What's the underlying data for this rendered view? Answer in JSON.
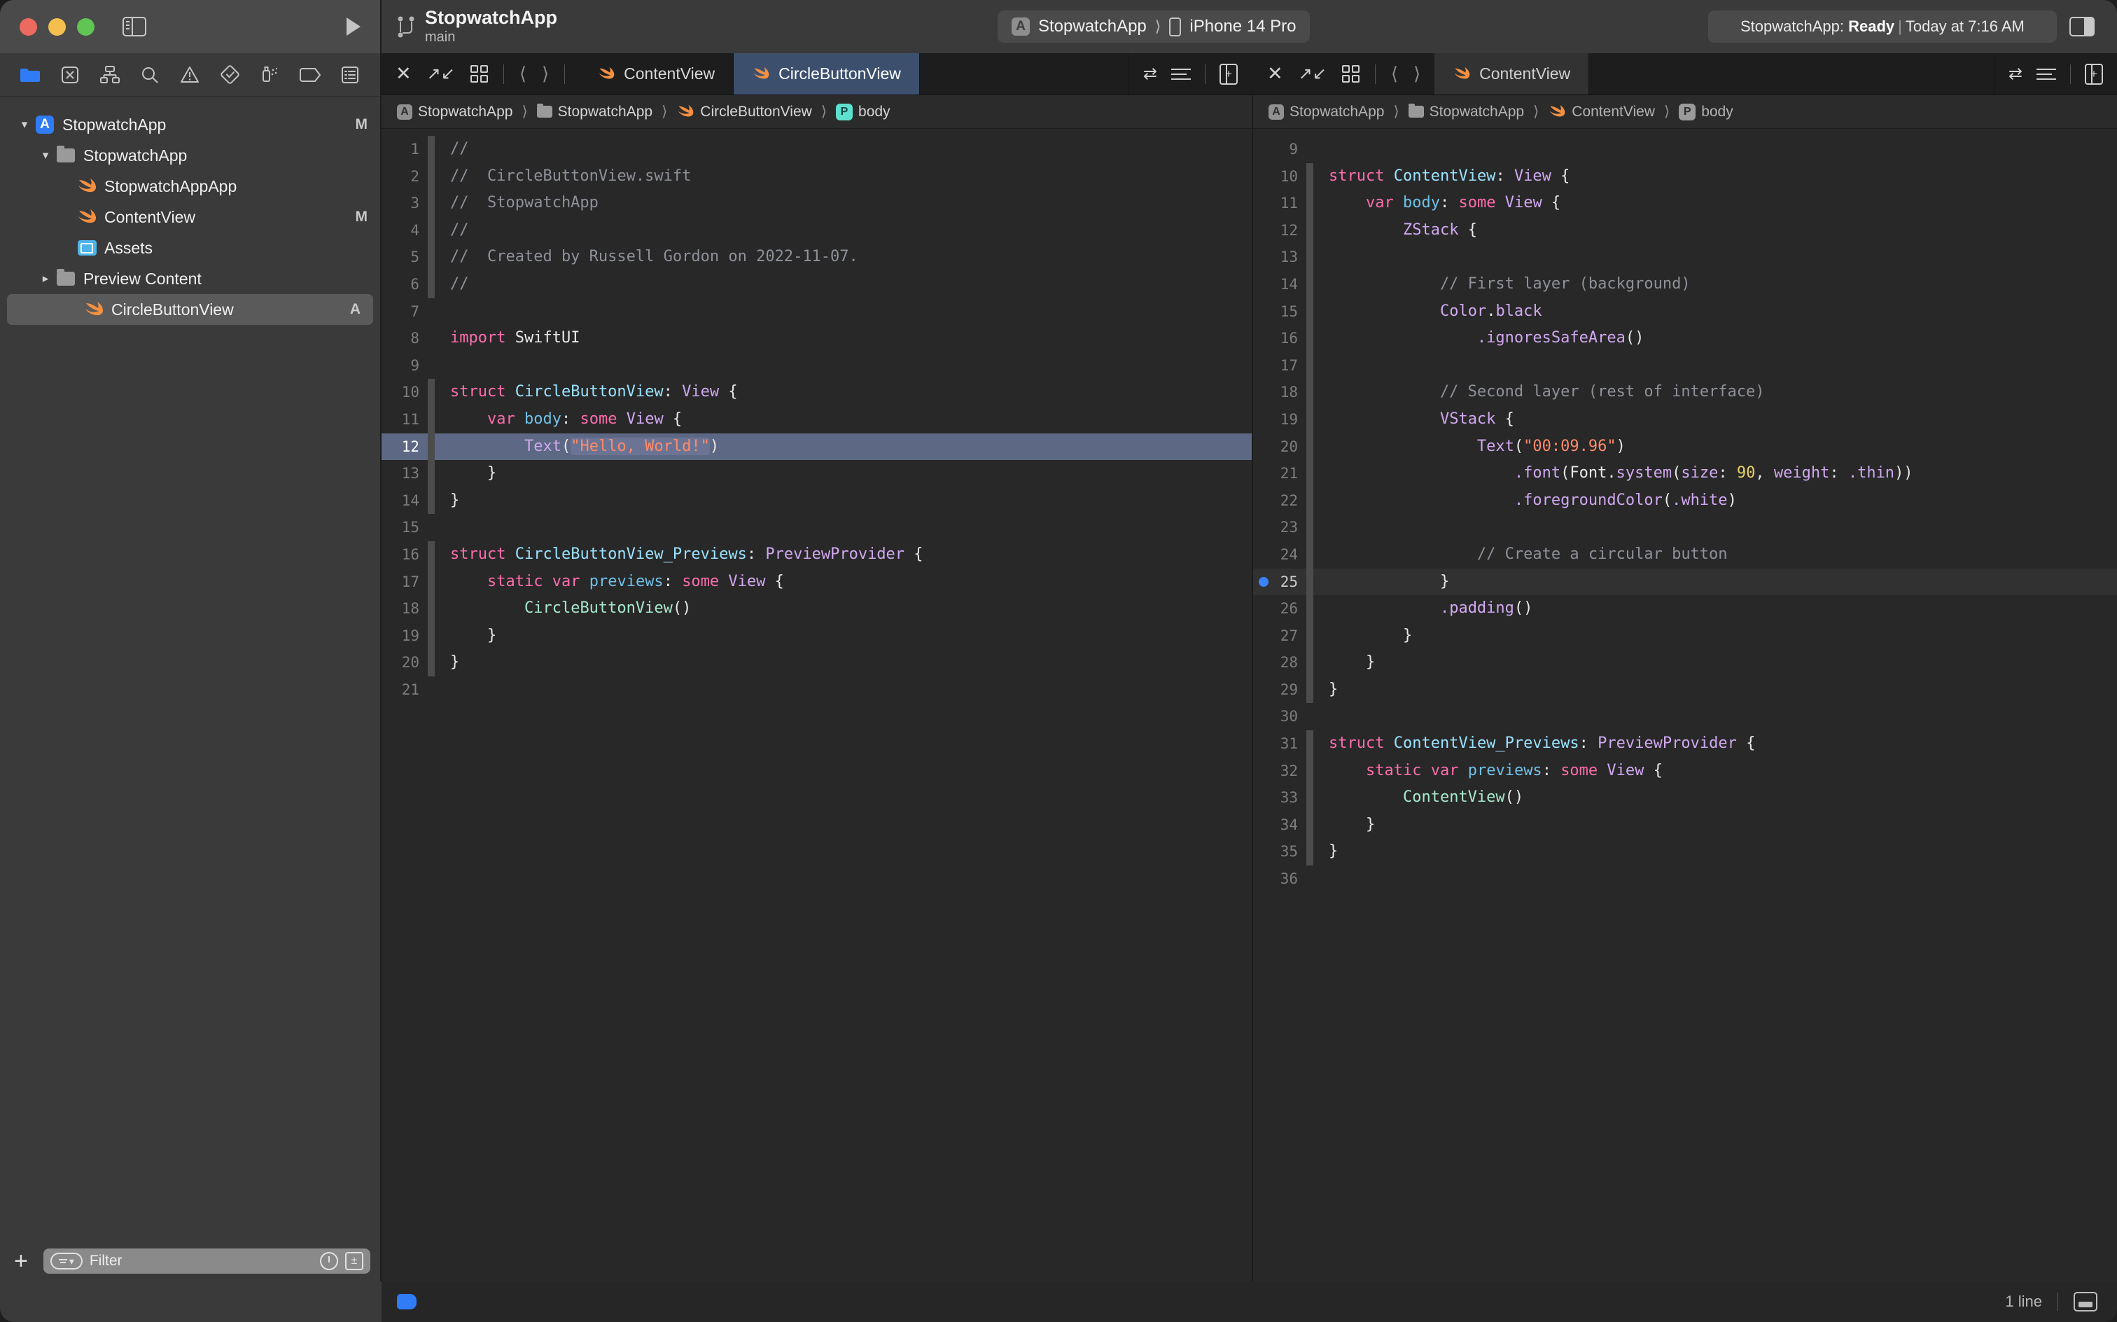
{
  "window": {
    "project_title": "StopwatchApp",
    "branch": "main",
    "traffic_lights": [
      "close-button",
      "minimize-button",
      "maximize-button"
    ]
  },
  "toolbar": {
    "scheme": "StopwatchApp",
    "destination": "iPhone 14 Pro",
    "status_prefix": "StopwatchApp: ",
    "status_state": "Ready",
    "status_suffix": "Today at 7:16 AM",
    "separator": "|",
    "add_label": "+"
  },
  "navigator": {
    "tabs": [
      "folder-icon",
      "source-control-icon",
      "hierarchy-icon",
      "search-icon",
      "warning-icon",
      "test-icon",
      "debug-icon",
      "breakpoint-icon",
      "report-icon"
    ],
    "tree": [
      {
        "label": "StopwatchApp",
        "icon": "xcodeproj-icon",
        "indent": 0,
        "twisty": "v",
        "badge": "M",
        "selected": false
      },
      {
        "label": "StopwatchApp",
        "icon": "folder-icon",
        "indent": 1,
        "twisty": "v",
        "badge": "",
        "selected": false
      },
      {
        "label": "StopwatchAppApp",
        "icon": "swift-icon",
        "indent": 2,
        "twisty": "",
        "badge": "",
        "selected": false
      },
      {
        "label": "ContentView",
        "icon": "swift-icon",
        "indent": 2,
        "twisty": "",
        "badge": "M",
        "selected": false
      },
      {
        "label": "Assets",
        "icon": "assets-icon",
        "indent": 2,
        "twisty": "",
        "badge": "",
        "selected": false
      },
      {
        "label": "Preview Content",
        "icon": "folder-icon",
        "indent": 1,
        "twisty": ">",
        "badge": "",
        "selected": false
      },
      {
        "label": "CircleButtonView",
        "icon": "swift-icon",
        "indent": 2,
        "twisty": "",
        "badge": "A",
        "selected": true
      }
    ],
    "filter_placeholder": "Filter"
  },
  "editor_left": {
    "tabs": [
      {
        "label": "ContentView",
        "state": "inactive"
      },
      {
        "label": "CircleButtonView",
        "state": "active"
      }
    ],
    "breadcrumb": [
      {
        "label": "StopwatchApp",
        "icon": "xcodeproj-icon"
      },
      {
        "label": "StopwatchApp",
        "icon": "folder-icon"
      },
      {
        "label": "CircleButtonView",
        "icon": "swift-icon"
      },
      {
        "label": "body",
        "icon": "property-icon"
      }
    ],
    "lines": [
      {
        "n": "1",
        "ribbon": true,
        "hl": "",
        "tokens": [
          {
            "t": "//",
            "c": "c-cmt"
          }
        ]
      },
      {
        "n": "2",
        "ribbon": true,
        "hl": "",
        "tokens": [
          {
            "t": "//  CircleButtonView.swift",
            "c": "c-cmt"
          }
        ]
      },
      {
        "n": "3",
        "ribbon": true,
        "hl": "",
        "tokens": [
          {
            "t": "//  StopwatchApp",
            "c": "c-cmt"
          }
        ]
      },
      {
        "n": "4",
        "ribbon": true,
        "hl": "",
        "tokens": [
          {
            "t": "//",
            "c": "c-cmt"
          }
        ]
      },
      {
        "n": "5",
        "ribbon": true,
        "hl": "",
        "tokens": [
          {
            "t": "//  Created by Russell Gordon on 2022-11-07.",
            "c": "c-cmt"
          }
        ]
      },
      {
        "n": "6",
        "ribbon": true,
        "hl": "",
        "tokens": [
          {
            "t": "//",
            "c": "c-cmt"
          }
        ]
      },
      {
        "n": "7",
        "ribbon": false,
        "hl": "",
        "tokens": []
      },
      {
        "n": "8",
        "ribbon": false,
        "hl": "",
        "tokens": [
          {
            "t": "import",
            "c": "c-kw"
          },
          {
            "t": " SwiftUI",
            "c": "c-plain"
          }
        ]
      },
      {
        "n": "9",
        "ribbon": false,
        "hl": "",
        "tokens": []
      },
      {
        "n": "10",
        "ribbon": true,
        "hl": "",
        "tokens": [
          {
            "t": "struct",
            "c": "c-kw"
          },
          {
            "t": " ",
            "c": "c-plain"
          },
          {
            "t": "CircleButtonView",
            "c": "c-type"
          },
          {
            "t": ": ",
            "c": "c-plain"
          },
          {
            "t": "View",
            "c": "c-prot"
          },
          {
            "t": " {",
            "c": "c-plain"
          }
        ]
      },
      {
        "n": "11",
        "ribbon": true,
        "hl": "",
        "tokens": [
          {
            "t": "    ",
            "c": "c-plain"
          },
          {
            "t": "var",
            "c": "c-kw"
          },
          {
            "t": " ",
            "c": "c-plain"
          },
          {
            "t": "body",
            "c": "c-var"
          },
          {
            "t": ": ",
            "c": "c-plain"
          },
          {
            "t": "some",
            "c": "c-kw"
          },
          {
            "t": " ",
            "c": "c-plain"
          },
          {
            "t": "View",
            "c": "c-prot"
          },
          {
            "t": " {",
            "c": "c-plain"
          }
        ]
      },
      {
        "n": "12",
        "ribbon": true,
        "hl": "hl",
        "tokens": [
          {
            "t": "        ",
            "c": "c-plain"
          },
          {
            "t": "Text",
            "c": "c-fn"
          },
          {
            "t": "(",
            "c": "c-plain"
          },
          {
            "t": "\"Hello, World!\"",
            "c": "c-str strsel"
          },
          {
            "t": ")",
            "c": "c-plain"
          }
        ]
      },
      {
        "n": "13",
        "ribbon": true,
        "hl": "",
        "tokens": [
          {
            "t": "    }",
            "c": "c-plain"
          }
        ]
      },
      {
        "n": "14",
        "ribbon": true,
        "hl": "",
        "tokens": [
          {
            "t": "}",
            "c": "c-plain"
          }
        ]
      },
      {
        "n": "15",
        "ribbon": false,
        "hl": "",
        "tokens": []
      },
      {
        "n": "16",
        "ribbon": true,
        "hl": "",
        "tokens": [
          {
            "t": "struct",
            "c": "c-kw"
          },
          {
            "t": " ",
            "c": "c-plain"
          },
          {
            "t": "CircleButtonView_Previews",
            "c": "c-type"
          },
          {
            "t": ": ",
            "c": "c-plain"
          },
          {
            "t": "PreviewProvider",
            "c": "c-prot"
          },
          {
            "t": " {",
            "c": "c-plain"
          }
        ]
      },
      {
        "n": "17",
        "ribbon": true,
        "hl": "",
        "tokens": [
          {
            "t": "    ",
            "c": "c-plain"
          },
          {
            "t": "static",
            "c": "c-kw"
          },
          {
            "t": " ",
            "c": "c-plain"
          },
          {
            "t": "var",
            "c": "c-kw"
          },
          {
            "t": " ",
            "c": "c-plain"
          },
          {
            "t": "previews",
            "c": "c-var"
          },
          {
            "t": ": ",
            "c": "c-plain"
          },
          {
            "t": "some",
            "c": "c-kw"
          },
          {
            "t": " ",
            "c": "c-plain"
          },
          {
            "t": "View",
            "c": "c-prot"
          },
          {
            "t": " {",
            "c": "c-plain"
          }
        ]
      },
      {
        "n": "18",
        "ribbon": true,
        "hl": "",
        "tokens": [
          {
            "t": "        ",
            "c": "c-plain"
          },
          {
            "t": "CircleButtonView",
            "c": "c-call"
          },
          {
            "t": "()",
            "c": "c-plain"
          }
        ]
      },
      {
        "n": "19",
        "ribbon": true,
        "hl": "",
        "tokens": [
          {
            "t": "    }",
            "c": "c-plain"
          }
        ]
      },
      {
        "n": "20",
        "ribbon": true,
        "hl": "",
        "tokens": [
          {
            "t": "}",
            "c": "c-plain"
          }
        ]
      },
      {
        "n": "21",
        "ribbon": false,
        "hl": "",
        "tokens": []
      }
    ]
  },
  "editor_right": {
    "tabs": [
      {
        "label": "ContentView",
        "state": "active"
      }
    ],
    "breadcrumb": [
      {
        "label": "StopwatchApp",
        "icon": "xcodeproj-icon"
      },
      {
        "label": "StopwatchApp",
        "icon": "folder-icon"
      },
      {
        "label": "ContentView",
        "icon": "swift-icon"
      },
      {
        "label": "body",
        "icon": "property-icon"
      }
    ],
    "lines": [
      {
        "n": "9",
        "ribbon": false,
        "hl": "",
        "bp": false,
        "tokens": []
      },
      {
        "n": "10",
        "ribbon": true,
        "hl": "",
        "bp": false,
        "tokens": [
          {
            "t": "struct",
            "c": "c-kw"
          },
          {
            "t": " ",
            "c": "c-plain"
          },
          {
            "t": "ContentView",
            "c": "c-type"
          },
          {
            "t": ": ",
            "c": "c-plain"
          },
          {
            "t": "View",
            "c": "c-prot"
          },
          {
            "t": " {",
            "c": "c-plain"
          }
        ]
      },
      {
        "n": "11",
        "ribbon": true,
        "hl": "",
        "bp": false,
        "tokens": [
          {
            "t": "    ",
            "c": "c-plain"
          },
          {
            "t": "var",
            "c": "c-kw"
          },
          {
            "t": " ",
            "c": "c-plain"
          },
          {
            "t": "body",
            "c": "c-var"
          },
          {
            "t": ": ",
            "c": "c-plain"
          },
          {
            "t": "some",
            "c": "c-kw"
          },
          {
            "t": " ",
            "c": "c-plain"
          },
          {
            "t": "View",
            "c": "c-prot"
          },
          {
            "t": " {",
            "c": "c-plain"
          }
        ]
      },
      {
        "n": "12",
        "ribbon": true,
        "hl": "",
        "bp": false,
        "tokens": [
          {
            "t": "        ",
            "c": "c-plain"
          },
          {
            "t": "ZStack",
            "c": "c-prot"
          },
          {
            "t": " {",
            "c": "c-plain"
          }
        ]
      },
      {
        "n": "13",
        "ribbon": true,
        "hl": "",
        "bp": false,
        "tokens": []
      },
      {
        "n": "14",
        "ribbon": true,
        "hl": "",
        "bp": false,
        "tokens": [
          {
            "t": "            // First layer (background)",
            "c": "c-cmt"
          }
        ]
      },
      {
        "n": "15",
        "ribbon": true,
        "hl": "",
        "bp": false,
        "tokens": [
          {
            "t": "            ",
            "c": "c-plain"
          },
          {
            "t": "Color",
            "c": "c-fn"
          },
          {
            "t": ".",
            "c": "c-plain"
          },
          {
            "t": "black",
            "c": "c-prot"
          }
        ]
      },
      {
        "n": "16",
        "ribbon": true,
        "hl": "",
        "bp": false,
        "tokens": [
          {
            "t": "                ",
            "c": "c-plain"
          },
          {
            "t": ".ignoresSafeArea",
            "c": "c-fn"
          },
          {
            "t": "()",
            "c": "c-plain"
          }
        ]
      },
      {
        "n": "17",
        "ribbon": true,
        "hl": "",
        "bp": false,
        "tokens": []
      },
      {
        "n": "18",
        "ribbon": true,
        "hl": "",
        "bp": false,
        "tokens": [
          {
            "t": "            // Second layer (rest of interface)",
            "c": "c-cmt"
          }
        ]
      },
      {
        "n": "19",
        "ribbon": true,
        "hl": "",
        "bp": false,
        "tokens": [
          {
            "t": "            ",
            "c": "c-plain"
          },
          {
            "t": "VStack",
            "c": "c-prot"
          },
          {
            "t": " {",
            "c": "c-plain"
          }
        ]
      },
      {
        "n": "20",
        "ribbon": true,
        "hl": "",
        "bp": false,
        "tokens": [
          {
            "t": "                ",
            "c": "c-plain"
          },
          {
            "t": "Text",
            "c": "c-fn"
          },
          {
            "t": "(",
            "c": "c-plain"
          },
          {
            "t": "\"00:09.96\"",
            "c": "c-str"
          },
          {
            "t": ")",
            "c": "c-plain"
          }
        ]
      },
      {
        "n": "21",
        "ribbon": true,
        "hl": "",
        "bp": false,
        "tokens": [
          {
            "t": "                    ",
            "c": "c-plain"
          },
          {
            "t": ".font",
            "c": "c-fn"
          },
          {
            "t": "(",
            "c": "c-plain"
          },
          {
            "t": "Font",
            "c": "c-plain"
          },
          {
            "t": ".",
            "c": "c-plain"
          },
          {
            "t": "system",
            "c": "c-fn"
          },
          {
            "t": "(",
            "c": "c-plain"
          },
          {
            "t": "size",
            "c": "c-fn"
          },
          {
            "t": ": ",
            "c": "c-plain"
          },
          {
            "t": "90",
            "c": "c-num"
          },
          {
            "t": ", ",
            "c": "c-plain"
          },
          {
            "t": "weight",
            "c": "c-fn"
          },
          {
            "t": ": ",
            "c": "c-plain"
          },
          {
            "t": ".thin",
            "c": "c-fn"
          },
          {
            "t": "))",
            "c": "c-plain"
          }
        ]
      },
      {
        "n": "22",
        "ribbon": true,
        "hl": "",
        "bp": false,
        "tokens": [
          {
            "t": "                    ",
            "c": "c-plain"
          },
          {
            "t": ".foregroundColor",
            "c": "c-fn"
          },
          {
            "t": "(",
            "c": "c-plain"
          },
          {
            "t": ".white",
            "c": "c-fn"
          },
          {
            "t": ")",
            "c": "c-plain"
          }
        ]
      },
      {
        "n": "23",
        "ribbon": true,
        "hl": "",
        "bp": false,
        "tokens": []
      },
      {
        "n": "24",
        "ribbon": true,
        "hl": "",
        "bp": false,
        "tokens": [
          {
            "t": "                // Create a circular button",
            "c": "c-cmt"
          }
        ]
      },
      {
        "n": "25",
        "ribbon": true,
        "hl": "hl-soft",
        "bp": true,
        "tokens": [
          {
            "t": "            }",
            "c": "c-plain"
          }
        ]
      },
      {
        "n": "26",
        "ribbon": true,
        "hl": "",
        "bp": false,
        "tokens": [
          {
            "t": "            ",
            "c": "c-plain"
          },
          {
            "t": ".padding",
            "c": "c-fn"
          },
          {
            "t": "()",
            "c": "c-plain"
          }
        ]
      },
      {
        "n": "27",
        "ribbon": true,
        "hl": "",
        "bp": false,
        "tokens": [
          {
            "t": "        }",
            "c": "c-plain"
          }
        ]
      },
      {
        "n": "28",
        "ribbon": true,
        "hl": "",
        "bp": false,
        "tokens": [
          {
            "t": "    }",
            "c": "c-plain"
          }
        ]
      },
      {
        "n": "29",
        "ribbon": true,
        "hl": "",
        "bp": false,
        "tokens": [
          {
            "t": "}",
            "c": "c-plain"
          }
        ]
      },
      {
        "n": "30",
        "ribbon": false,
        "hl": "",
        "bp": false,
        "tokens": []
      },
      {
        "n": "31",
        "ribbon": true,
        "hl": "",
        "bp": false,
        "tokens": [
          {
            "t": "struct",
            "c": "c-kw"
          },
          {
            "t": " ",
            "c": "c-plain"
          },
          {
            "t": "ContentView_Previews",
            "c": "c-type"
          },
          {
            "t": ": ",
            "c": "c-plain"
          },
          {
            "t": "PreviewProvider",
            "c": "c-prot"
          },
          {
            "t": " {",
            "c": "c-plain"
          }
        ]
      },
      {
        "n": "32",
        "ribbon": true,
        "hl": "",
        "bp": false,
        "tokens": [
          {
            "t": "    ",
            "c": "c-plain"
          },
          {
            "t": "static",
            "c": "c-kw"
          },
          {
            "t": " ",
            "c": "c-plain"
          },
          {
            "t": "var",
            "c": "c-kw"
          },
          {
            "t": " ",
            "c": "c-plain"
          },
          {
            "t": "previews",
            "c": "c-var"
          },
          {
            "t": ": ",
            "c": "c-plain"
          },
          {
            "t": "some",
            "c": "c-kw"
          },
          {
            "t": " ",
            "c": "c-plain"
          },
          {
            "t": "View",
            "c": "c-prot"
          },
          {
            "t": " {",
            "c": "c-plain"
          }
        ]
      },
      {
        "n": "33",
        "ribbon": true,
        "hl": "",
        "bp": false,
        "tokens": [
          {
            "t": "        ",
            "c": "c-plain"
          },
          {
            "t": "ContentView",
            "c": "c-call"
          },
          {
            "t": "()",
            "c": "c-plain"
          }
        ]
      },
      {
        "n": "34",
        "ribbon": true,
        "hl": "",
        "bp": false,
        "tokens": [
          {
            "t": "    }",
            "c": "c-plain"
          }
        ]
      },
      {
        "n": "35",
        "ribbon": true,
        "hl": "",
        "bp": false,
        "tokens": [
          {
            "t": "}",
            "c": "c-plain"
          }
        ]
      },
      {
        "n": "36",
        "ribbon": false,
        "hl": "",
        "bp": false,
        "tokens": []
      }
    ]
  },
  "footer": {
    "line_count": "1 line"
  },
  "colors": {
    "accent": "#2f7cf6",
    "tab_active": "#3c506e",
    "swift_orange": "#f59042",
    "highlight": "#5d6885"
  }
}
